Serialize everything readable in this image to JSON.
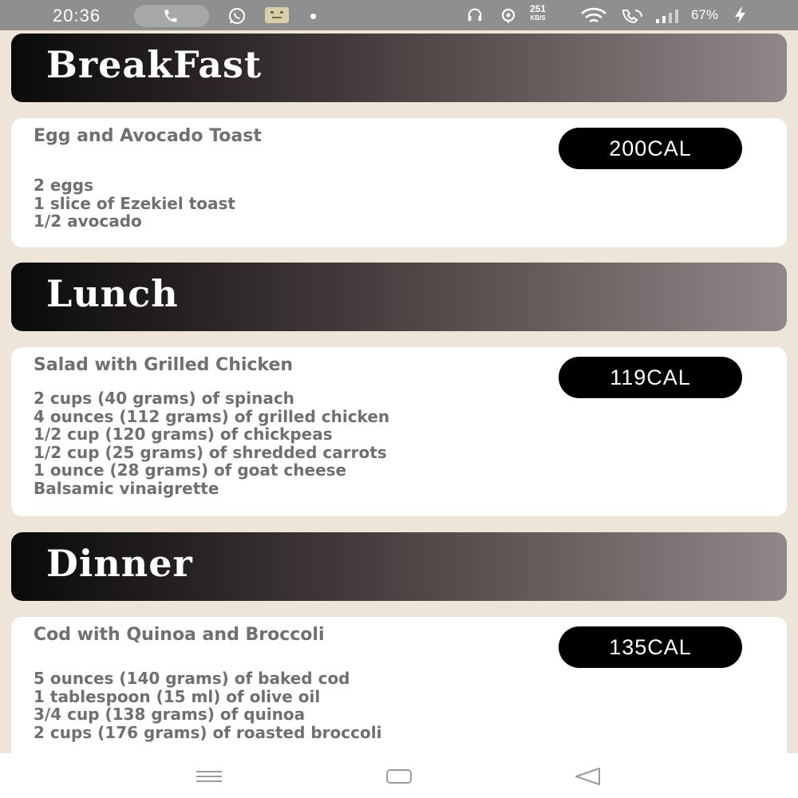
{
  "status_bar": {
    "time": "20:36",
    "net_speed_value": "251",
    "net_speed_unit": "KB/S",
    "battery": "67%",
    "icons": [
      "phone-icon",
      "whatsapp-icon",
      "notification-app-icon",
      "dot-icon",
      "headset-icon",
      "location-icon",
      "wifi-icon",
      "wifi-calling-icon",
      "signal-icon",
      "charging-icon"
    ]
  },
  "sections": {
    "breakfast": {
      "title": "BreakFast",
      "meal": {
        "name": "Egg and Avocado Toast",
        "calories": "200CAL",
        "ingredients": [
          "2 eggs",
          "1 slice of Ezekiel toast",
          "1/2 avocado"
        ]
      }
    },
    "lunch": {
      "title": "Lunch",
      "meal": {
        "name": "Salad with Grilled Chicken",
        "calories": "119CAL",
        "ingredients": [
          "2 cups (40 grams) of spinach",
          "4 ounces (112 grams) of grilled chicken",
          "1/2 cup (120 grams) of chickpeas",
          "1/2 cup (25 grams) of shredded carrots",
          "1 ounce (28 grams) of goat cheese",
          "Balsamic vinaigrette"
        ]
      }
    },
    "dinner": {
      "title": "Dinner",
      "meal": {
        "name": "Cod with Quinoa and Broccoli",
        "calories": "135CAL",
        "ingredients": [
          "5 ounces (140 grams) of baked cod",
          "1 tablespoon (15 ml) of olive oil",
          "3/4 cup (138 grams) of quinoa",
          "2 cups (176 grams) of roasted broccoli"
        ]
      }
    }
  },
  "nav_bar": {
    "icons": [
      "menu-icon",
      "home-icon",
      "back-icon"
    ]
  },
  "colors": {
    "background": "#efe4d8",
    "header_gradient_start": "#0a0a0a",
    "header_gradient_end": "#908888",
    "card": "#ffffff",
    "badge": "#000000",
    "text_muted": "#6f6f6f"
  }
}
